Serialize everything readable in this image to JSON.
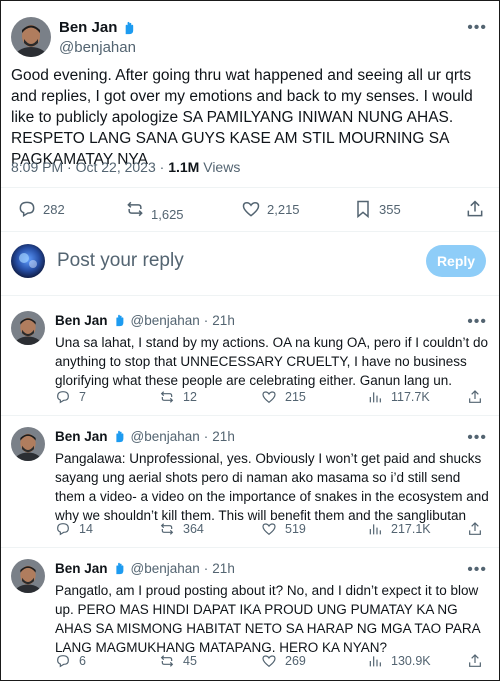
{
  "main_tweet": {
    "author": {
      "name": "Ben Jan",
      "handle": "@benjahan"
    },
    "text": "Good evening. After going thru wat happened and seeing all ur qrts and replies, I got over my emotions and back to my senses. I would like to publicly apologize SA PAMILYANG INIWAN NUNG AHAS. RESPETO LANG SANA GUYS KASE AM STIL MOURNING SA PAGKAMATAY NYA",
    "time": "8:09 PM",
    "date": "Oct 22, 2023",
    "views_count": "1.1M",
    "views_label": "Views",
    "actions": {
      "replies": "282",
      "reposts": "1,625",
      "likes": "2,215",
      "bookmarks": "355"
    }
  },
  "composer": {
    "placeholder": "Post your reply",
    "button_label": "Reply"
  },
  "replies": [
    {
      "name": "Ben Jan",
      "handle": "@benjahan",
      "time": "21h",
      "text": "Una sa lahat, I stand by my actions. OA na kung OA, pero if I couldn’t do anything to stop that UNNECESSARY CRUELTY, I have no business glorifying what these people are celebrating either. Ganun lang un.",
      "replies": "7",
      "reposts": "12",
      "likes": "215",
      "views": "117.7K"
    },
    {
      "name": "Ben Jan",
      "handle": "@benjahan",
      "time": "21h",
      "text": "Pangalawa: Unprofessional, yes. Obviously I won’t get paid and shucks sayang ung aerial shots pero di naman ako masama so i’d still send them a video- a video on the importance of snakes in the ecosystem and why we shouldn’t kill them. This will benefit them and the sanglibutan",
      "replies": "14",
      "reposts": "364",
      "likes": "519",
      "views": "217.1K"
    },
    {
      "name": "Ben Jan",
      "handle": "@benjahan",
      "time": "21h",
      "text": "Pangatlo, am I proud posting about it? No, and I didn’t expect it to blow up. PERO MAS HINDI DAPAT IKA PROUD UNG PUMATAY KA NG AHAS SA MISMONG HABITAT NETO SA HARAP NG MGA TAO PARA LANG MAGMUKHANG MATAPANG. HERO KA NYAN?",
      "replies": "6",
      "reposts": "45",
      "likes": "269",
      "views": "130.9K"
    }
  ],
  "colors": {
    "text": "#0f1419",
    "muted": "#536471",
    "reply_button": "#8ecdf8",
    "divider": "#eff3f4",
    "badge": "#1d9bf0"
  },
  "icons": [
    "more-icon",
    "reply-icon",
    "repost-icon",
    "like-icon",
    "bookmark-icon",
    "share-icon",
    "views-icon",
    "hand-badge-icon"
  ]
}
